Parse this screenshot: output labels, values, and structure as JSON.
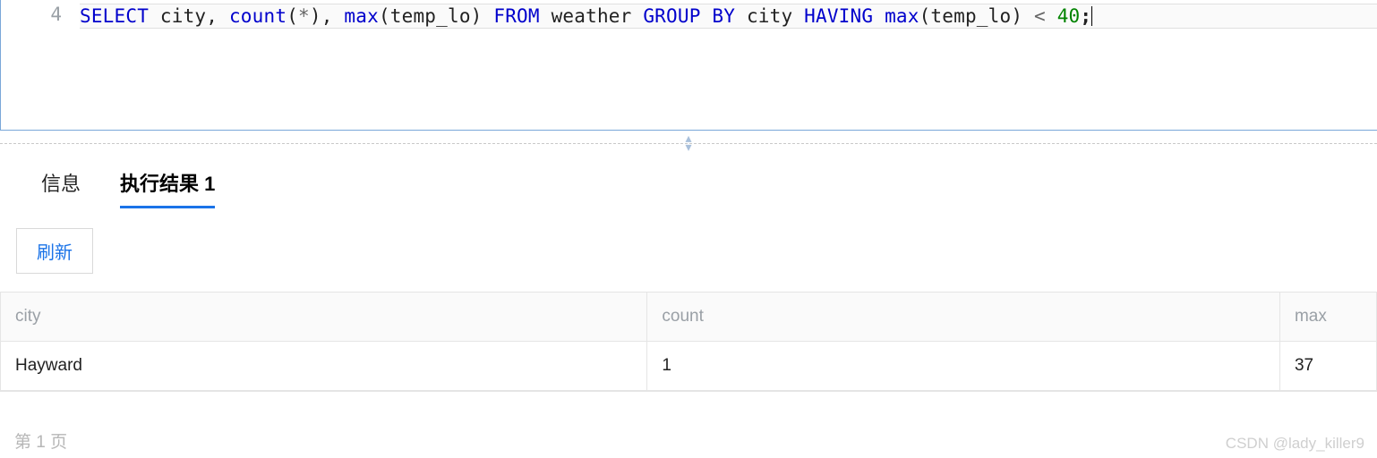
{
  "editor": {
    "line_no": "4",
    "tokens": [
      {
        "t": "SELECT ",
        "c": "tok-kw"
      },
      {
        "t": "city, ",
        "c": "tok-id"
      },
      {
        "t": "count",
        "c": "tok-fn"
      },
      {
        "t": "(",
        "c": "tok-id"
      },
      {
        "t": "*",
        "c": "tok-op"
      },
      {
        "t": "), ",
        "c": "tok-id"
      },
      {
        "t": "max",
        "c": "tok-fn"
      },
      {
        "t": "(temp_lo) ",
        "c": "tok-id"
      },
      {
        "t": "FROM ",
        "c": "tok-kw"
      },
      {
        "t": "weather ",
        "c": "tok-id"
      },
      {
        "t": "GROUP BY ",
        "c": "tok-kw"
      },
      {
        "t": "city ",
        "c": "tok-id"
      },
      {
        "t": "HAVING ",
        "c": "tok-kw"
      },
      {
        "t": "max",
        "c": "tok-fn"
      },
      {
        "t": "(temp_lo) ",
        "c": "tok-id"
      },
      {
        "t": "< ",
        "c": "tok-op"
      },
      {
        "t": "40",
        "c": "tok-num"
      },
      {
        "t": ";",
        "c": "tok-punc"
      }
    ]
  },
  "tabs": {
    "info_label": "信息",
    "result_label": "执行结果 1"
  },
  "toolbar": {
    "refresh_label": "刷新"
  },
  "table": {
    "headers": [
      "city",
      "count",
      "max"
    ],
    "rows": [
      [
        "Hayward",
        "1",
        "37"
      ]
    ]
  },
  "footer": {
    "pager": "第 1 页",
    "watermark": "CSDN @lady_killer9"
  },
  "splitter": {
    "up": "▴",
    "down": "▾"
  }
}
